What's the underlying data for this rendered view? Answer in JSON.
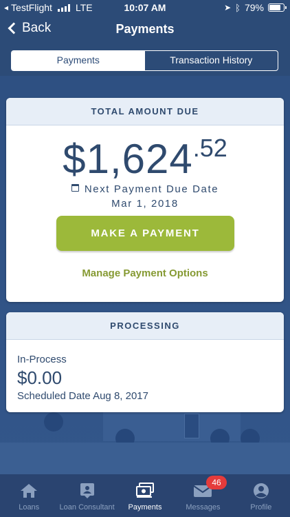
{
  "status": {
    "carrier": "TestFlight",
    "network": "LTE",
    "time": "10:07 AM",
    "battery": "79%",
    "battery_level": 0.79
  },
  "nav": {
    "back_label": "Back",
    "title": "Payments"
  },
  "segments": [
    {
      "label": "Payments",
      "active": true
    },
    {
      "label": "Transaction History",
      "active": false
    }
  ],
  "total_due": {
    "header": "TOTAL AMOUNT DUE",
    "amount_whole": "$1,624",
    "amount_cents": ".52",
    "next_due_label": "Next Payment Due Date",
    "next_due_date": "Mar 1, 2018",
    "pay_button": "MAKE A PAYMENT",
    "manage_link": "Manage Payment Options"
  },
  "processing": {
    "header": "PROCESSING",
    "status_label": "In-Process",
    "amount": "$0.00",
    "scheduled": "Scheduled Date Aug 8, 2017"
  },
  "tabs": [
    {
      "label": "Loans",
      "icon": "home-icon"
    },
    {
      "label": "Loan Consultant",
      "icon": "consultant-icon"
    },
    {
      "label": "Payments",
      "icon": "payments-icon"
    },
    {
      "label": "Messages",
      "icon": "mail-icon"
    },
    {
      "label": "Profile",
      "icon": "profile-icon"
    }
  ],
  "messages_badge": "46",
  "colors": {
    "header_bg": "#2c4b77",
    "accent_green": "#9cb93a",
    "text_navy": "#2f4a6e",
    "badge_red": "#e53b3b"
  }
}
